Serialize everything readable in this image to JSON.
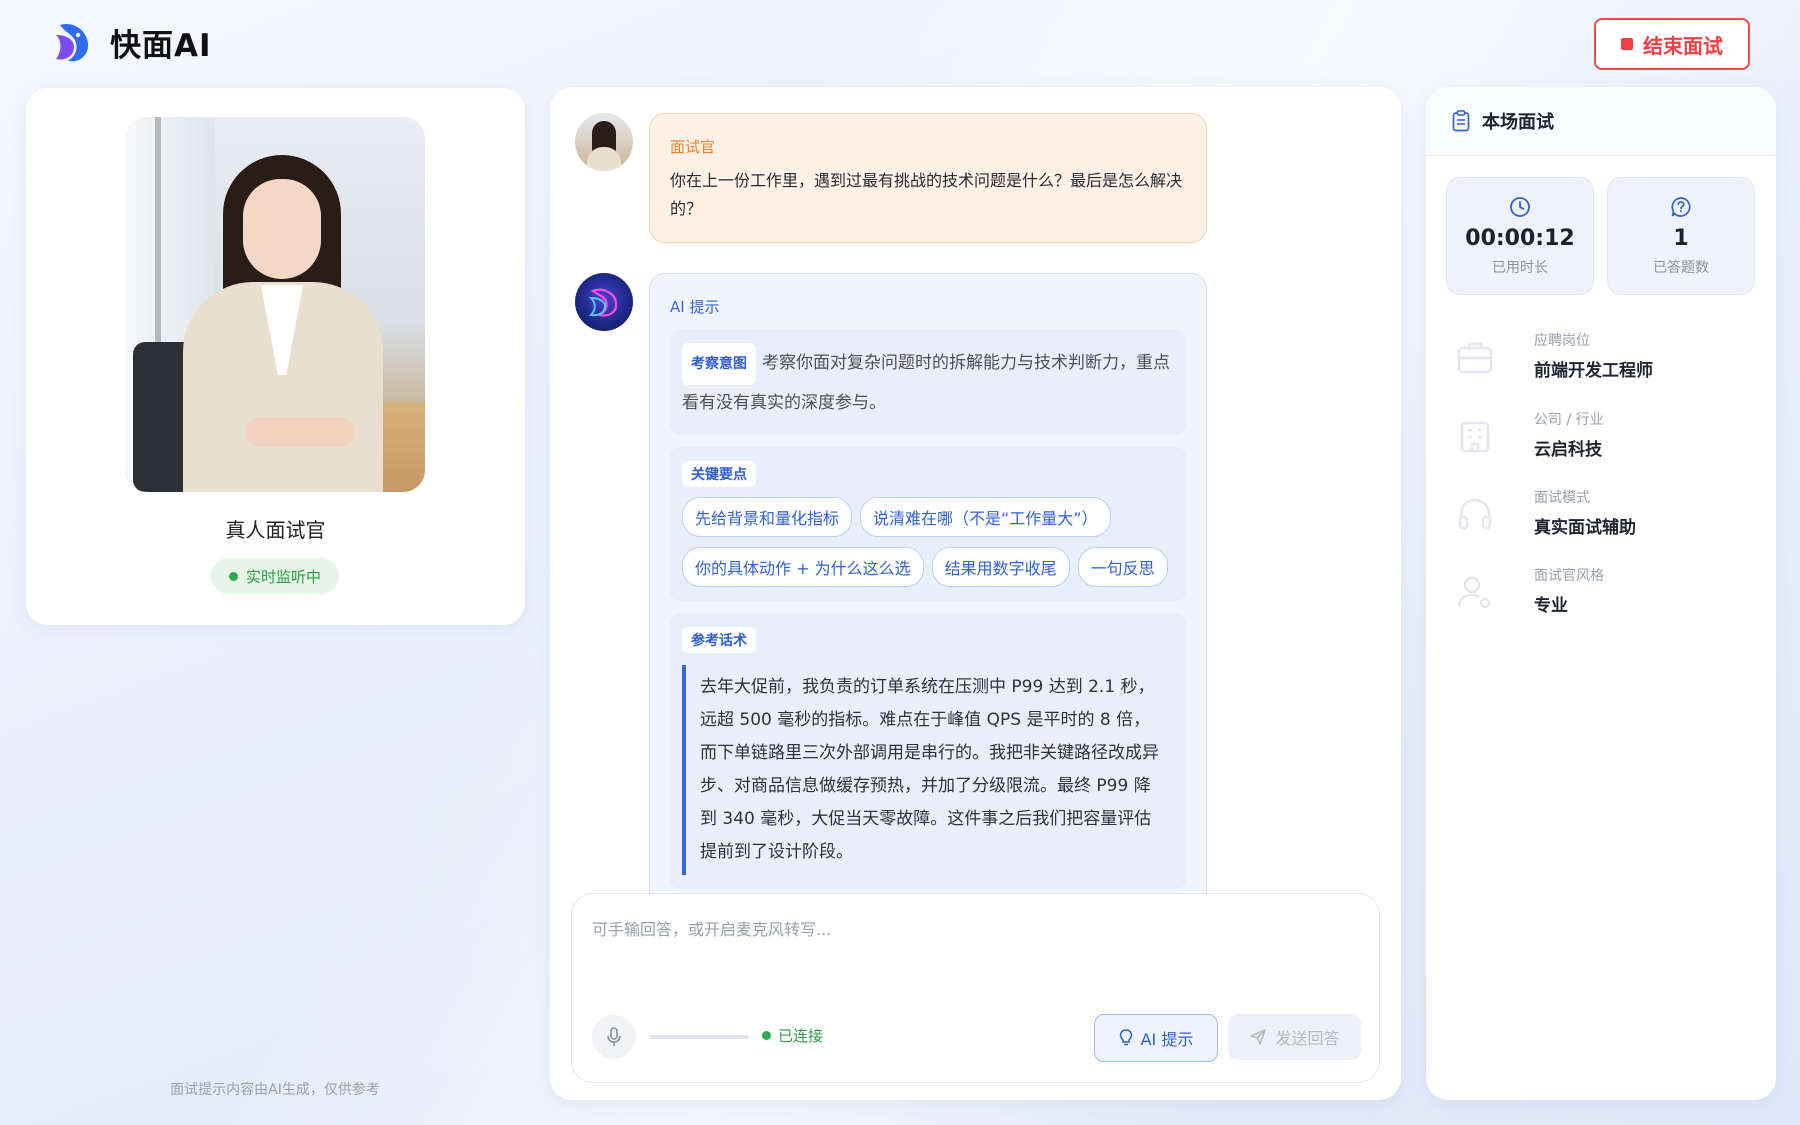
{
  "header": {
    "brand": "快面AI",
    "end_button": "结束面试"
  },
  "left": {
    "name": "真人面试官",
    "status": "实时监听中",
    "footnote": "面试提示内容由AI生成，仅供参考"
  },
  "chat": {
    "question": {
      "speaker": "面试官",
      "text": "你在上一份工作里，遇到过最有挑战的技术问题是什么？最后是怎么解决的？"
    },
    "ai_hint": {
      "speaker": "AI 提示",
      "intent_tag": "考察意图",
      "intent_text": "考察你面对复杂问题时的拆解能力与技术判断力，重点看有没有真实的深度参与。",
      "keypoints_tag": "关键要点",
      "keypoints": [
        "先给背景和量化指标",
        "说清难在哪（不是“工作量大”）",
        "你的具体动作 + 为什么这么选",
        "结果用数字收尾",
        "一句反思"
      ],
      "reference_tag": "参考话术",
      "reference_text": "去年大促前，我负责的订单系统在压测中 P99 达到 2.1 秒，远超 500 毫秒的指标。难点在于峰值 QPS 是平时的 8 倍，而下单链路里三次外部调用是串行的。我把非关键路径改成异步、对商品信息做缓存预热，并加了分级限流。最终 P99 降到 340 毫秒，大促当天零故障。这件事之后我们把容量评估提前到了设计阶段。"
    },
    "input": {
      "placeholder": "可手输回答，或开启麦克风转写...",
      "connection": "已连接",
      "ai_button": "AI 提示",
      "send_button": "发送回答"
    }
  },
  "right": {
    "title": "本场面试",
    "stats": [
      {
        "value": "00:00:12",
        "label": "已用时长",
        "icon": "clock-icon"
      },
      {
        "value": "1",
        "label": "已答题数",
        "icon": "question-icon"
      }
    ],
    "info": [
      {
        "label": "应聘岗位",
        "value": "前端开发工程师",
        "icon": "briefcase-icon"
      },
      {
        "label": "公司 / 行业",
        "value": "云启科技",
        "icon": "building-icon"
      },
      {
        "label": "面试模式",
        "value": "真实面试辅助",
        "icon": "headphones-icon"
      },
      {
        "label": "面试官风格",
        "value": "专业",
        "icon": "user-gear-icon"
      }
    ]
  },
  "colors": {
    "accent": "#3261d2",
    "danger": "#ef3f45",
    "success": "#2faa4f",
    "question": "#f0812e"
  }
}
